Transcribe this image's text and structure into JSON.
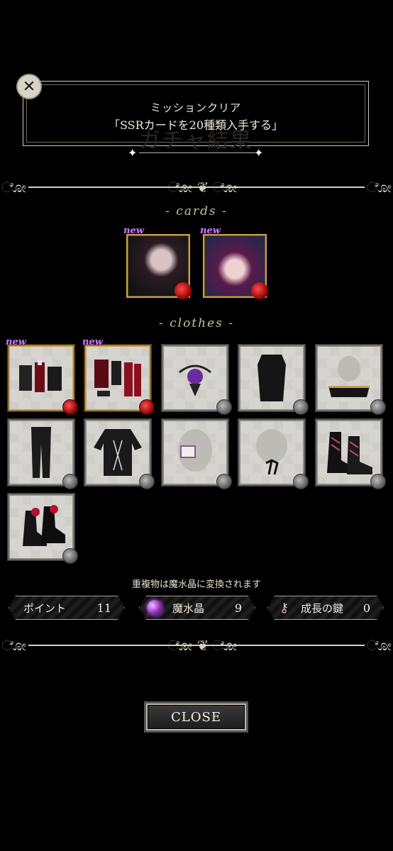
{
  "mission": {
    "heading": "ミッションクリア",
    "detail": "「SSRカードを20種類入手する」",
    "background_title": "ガチャ結果"
  },
  "sections": {
    "cards_label": "- cards -",
    "clothes_label": "- clothes -"
  },
  "new_tag": "new",
  "cards": [
    {
      "name": "card-dark-hair-character",
      "is_new": true
    },
    {
      "name": "card-purple-hair-character",
      "is_new": true
    }
  ],
  "clothes": [
    {
      "icon": "outfit-set-black-red-icon",
      "is_new": true,
      "rarity": "gold"
    },
    {
      "icon": "outfit-set-red-black-icon",
      "is_new": true,
      "rarity": "gold"
    },
    {
      "icon": "purple-rose-headpiece-icon",
      "is_new": false,
      "rarity": "normal"
    },
    {
      "icon": "black-dress-icon",
      "is_new": false,
      "rarity": "normal"
    },
    {
      "icon": "black-collar-icon",
      "is_new": false,
      "rarity": "normal"
    },
    {
      "icon": "black-pants-icon",
      "is_new": false,
      "rarity": "normal"
    },
    {
      "icon": "laced-shirt-icon",
      "is_new": false,
      "rarity": "normal"
    },
    {
      "icon": "eyepatch-icon",
      "is_new": false,
      "rarity": "normal"
    },
    {
      "icon": "neck-ribbon-icon",
      "is_new": false,
      "rarity": "normal"
    },
    {
      "icon": "laced-boots-icon",
      "is_new": false,
      "rarity": "normal"
    },
    {
      "icon": "red-ribbon-heels-icon",
      "is_new": false,
      "rarity": "normal"
    }
  ],
  "note": "重複物は魔水晶に変換されます",
  "resources": {
    "points": {
      "label": "ポイント",
      "value": "11"
    },
    "crystal": {
      "label": "魔水晶",
      "value": "9"
    },
    "key": {
      "label": "成長の鍵",
      "value": "0"
    }
  },
  "close_button": "CLOSE",
  "colors": {
    "background": "#000000",
    "gold_frame": "#c9a24a",
    "new_tag": "#c67cff",
    "frame_light": "#d7d0c2"
  }
}
